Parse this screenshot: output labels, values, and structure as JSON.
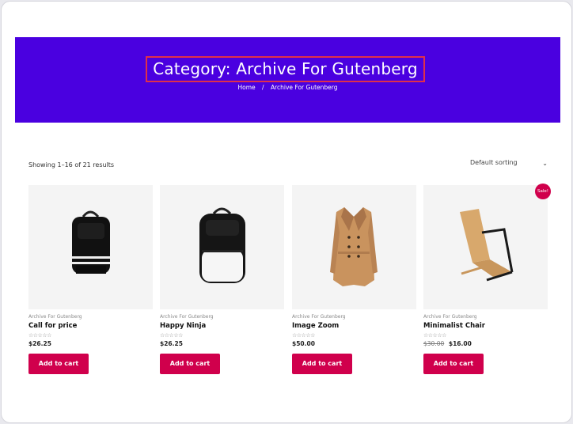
{
  "hero": {
    "title": "Category: Archive For Gutenberg",
    "breadcrumb": {
      "home": "Home",
      "separator": "/",
      "current": "Archive For Gutenberg"
    }
  },
  "toolbar": {
    "result_count": "Showing 1–16 of 21 results",
    "sorting": "Default sorting"
  },
  "colors": {
    "hero_bg": "#4a00e0",
    "accent": "#d0004c"
  },
  "products": [
    {
      "category": "Archive For Gutenberg",
      "name": "Call for price",
      "rating": "☆☆☆☆☆",
      "price": "$26.25",
      "button": "Add to cart"
    },
    {
      "category": "Archive For Gutenberg",
      "name": "Happy Ninja",
      "rating": "☆☆☆☆☆",
      "price": "$26.25",
      "button": "Add to cart"
    },
    {
      "category": "Archive For Gutenberg",
      "name": "Image Zoom",
      "rating": "☆☆☆☆☆",
      "price": "$50.00",
      "button": "Add to cart"
    },
    {
      "category": "Archive For Gutenberg",
      "name": "Minimalist Chair",
      "rating": "☆☆☆☆☆",
      "old_price": "$30.00",
      "price": "$16.00",
      "badge": "Sale!",
      "button": "Add to cart"
    }
  ]
}
